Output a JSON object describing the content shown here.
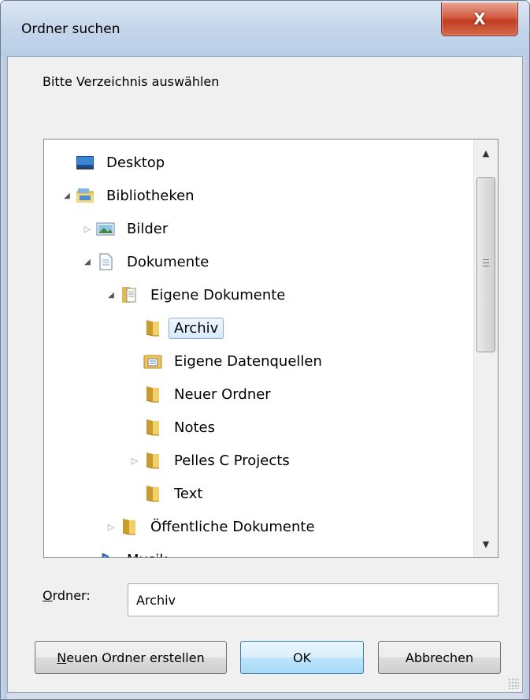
{
  "window": {
    "title": "Ordner suchen",
    "close_glyph": "X"
  },
  "prompt": "Bitte Verzeichnis auswählen",
  "tree": [
    {
      "label": "Desktop",
      "icon": "desktop-icon",
      "toggle": "none",
      "level": 0
    },
    {
      "label": "Bibliotheken",
      "icon": "libraries-icon",
      "toggle": "expanded",
      "level": 0
    },
    {
      "label": "Bilder",
      "icon": "pictures-icon",
      "toggle": "collapsed",
      "level": 1
    },
    {
      "label": "Dokumente",
      "icon": "documents-icon",
      "toggle": "expanded",
      "level": 1
    },
    {
      "label": "Eigene Dokumente",
      "icon": "documents-folder-icon",
      "toggle": "expanded",
      "level": 2
    },
    {
      "label": "Archiv",
      "icon": "folder-icon",
      "toggle": "none",
      "level": 3,
      "selected": true
    },
    {
      "label": "Eigene Datenquellen",
      "icon": "datasource-folder-icon",
      "toggle": "none",
      "level": 3
    },
    {
      "label": "Neuer Ordner",
      "icon": "folder-icon",
      "toggle": "none",
      "level": 3
    },
    {
      "label": "Notes",
      "icon": "folder-icon",
      "toggle": "none",
      "level": 3
    },
    {
      "label": "Pelles C Projects",
      "icon": "folder-icon",
      "toggle": "collapsed",
      "level": 3
    },
    {
      "label": "Text",
      "icon": "folder-icon",
      "toggle": "none",
      "level": 3
    },
    {
      "label": "Öffentliche Dokumente",
      "icon": "folder-icon",
      "toggle": "collapsed",
      "level": 2
    },
    {
      "label": "Musik",
      "icon": "music-icon",
      "toggle": "collapsed",
      "level": 1
    }
  ],
  "folder_field": {
    "label": "Ordner:",
    "accel": "O",
    "label_rest": "rdner:",
    "value": "Archiv"
  },
  "buttons": {
    "new_folder": {
      "accel": "N",
      "rest": "euen Ordner erstellen"
    },
    "ok": "OK",
    "cancel": "Abbrechen"
  },
  "colors": {
    "selection_border": "#84acdd",
    "close_red": "#c23d22",
    "ok_border": "#3c7fb1"
  }
}
